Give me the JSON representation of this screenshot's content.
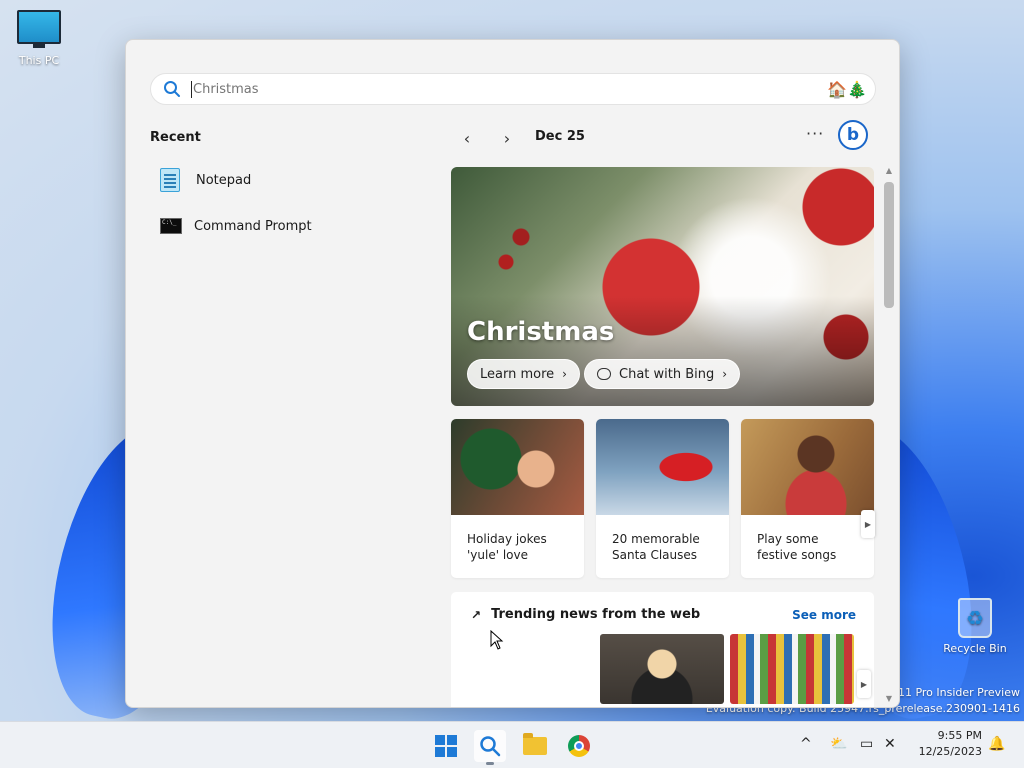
{
  "desktop": {
    "this_pc_label": "This PC",
    "recycle_bin_label": "Recycle Bin",
    "watermark_line1": "11 Pro Insider Preview",
    "watermark_line2": "Evaluation copy. Build 25947.rs_prerelease.230901-1416"
  },
  "search": {
    "placeholder": "Christmas",
    "icon": "search-icon",
    "doodle": "🏠🎄"
  },
  "recent": {
    "title": "Recent",
    "items": [
      {
        "label": "Notepad",
        "icon": "notepad-icon"
      },
      {
        "label": "Command Prompt",
        "icon": "command-prompt-icon"
      }
    ]
  },
  "highlights": {
    "date": "Dec 25",
    "prev_icon": "‹",
    "next_icon": "›",
    "more_icon": "···",
    "bing_letter": "b",
    "hero": {
      "title": "Christmas",
      "learn_more": "Learn more",
      "chat_with_bing": "Chat with Bing",
      "chevron": "›"
    },
    "cards": [
      {
        "caption": "Holiday jokes 'yule' love"
      },
      {
        "caption": "20 memorable Santa Clauses"
      },
      {
        "caption": "Play some festive songs"
      }
    ],
    "card_scroll_arrow": "▶",
    "trending": {
      "title": "Trending news from the web",
      "arrow": "↗",
      "see_more": "See more",
      "scroll_arrow": "▶"
    }
  },
  "scroll": {
    "up": "▲",
    "down": "▼"
  },
  "taskbar": {
    "tray_chevron": "^",
    "tray_network": "⛅",
    "tray_display": "▭",
    "tray_bell": "🔔",
    "time": "9:55 PM",
    "date": "12/25/2023"
  },
  "colors": {
    "accent": "#1e7ad6",
    "link": "#0b5fb8",
    "panel_bg": "#f3f3f3"
  }
}
